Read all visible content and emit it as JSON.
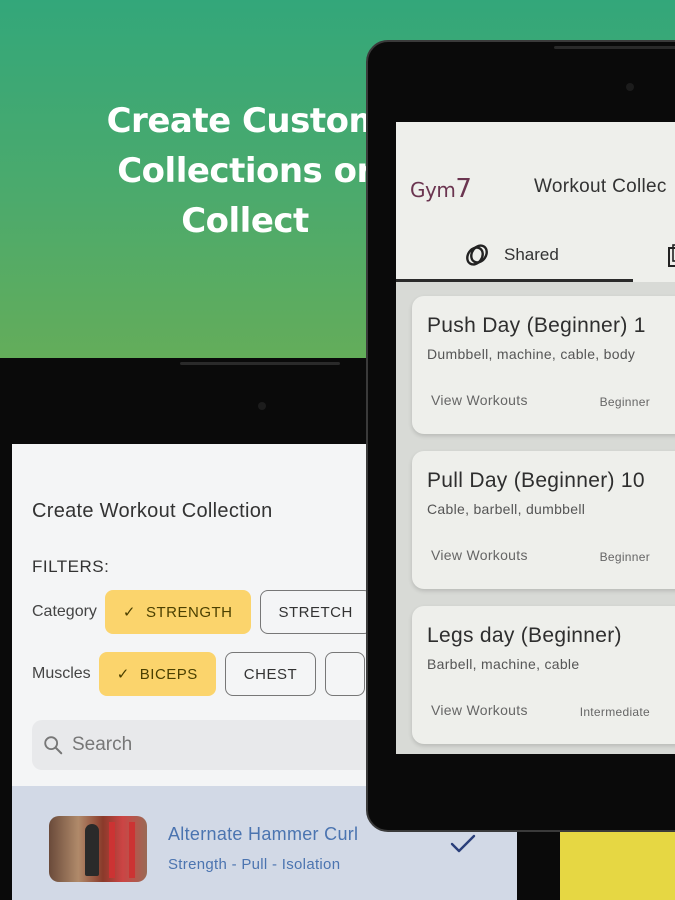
{
  "promo": {
    "headline_lines": [
      "Create Custom",
      "Collections or",
      "Collect"
    ]
  },
  "left_screen": {
    "title": "Create Workout Collection",
    "filters_label": "FILTERS:",
    "category": {
      "label": "Category",
      "chips": [
        {
          "label": "STRENGTH",
          "selected": true
        },
        {
          "label": "STRETCH",
          "selected": false
        }
      ]
    },
    "muscles": {
      "label": "Muscles",
      "chips": [
        {
          "label": "BICEPS",
          "selected": true
        },
        {
          "label": "CHEST",
          "selected": false
        },
        {
          "label": "",
          "selected": false
        }
      ]
    },
    "search": {
      "placeholder": "Search",
      "icon": "search-icon"
    },
    "result": {
      "name": "Alternate Hammer Curl",
      "tags": "Strength - Pull - Isolation",
      "checked": true
    }
  },
  "right_screen": {
    "logo": {
      "text": "Gym",
      "number": "7"
    },
    "title": "Workout Collec",
    "tabs": [
      {
        "label": "Shared",
        "icon": "rings-icon",
        "active": true
      },
      {
        "label": "",
        "icon": "library-icon",
        "active": false
      }
    ],
    "cards": [
      {
        "name": "Push Day (Beginner) 1",
        "equipment": "Dumbbell, machine, cable, body",
        "action": "View Workouts",
        "level": "Beginner"
      },
      {
        "name": "Pull Day (Beginner) 10",
        "equipment": "Cable, barbell, dumbbell",
        "action": "View Workouts",
        "level": "Beginner"
      },
      {
        "name": "Legs day (Beginner)",
        "equipment": "Barbell, machine, cable",
        "action": "View Workouts",
        "level": "Intermediate"
      }
    ]
  },
  "colors": {
    "accent_chip": "#fbd46c",
    "selected_row": "#d2d9e6",
    "link_blue": "#4b74b0",
    "brand": "#6b3550"
  }
}
